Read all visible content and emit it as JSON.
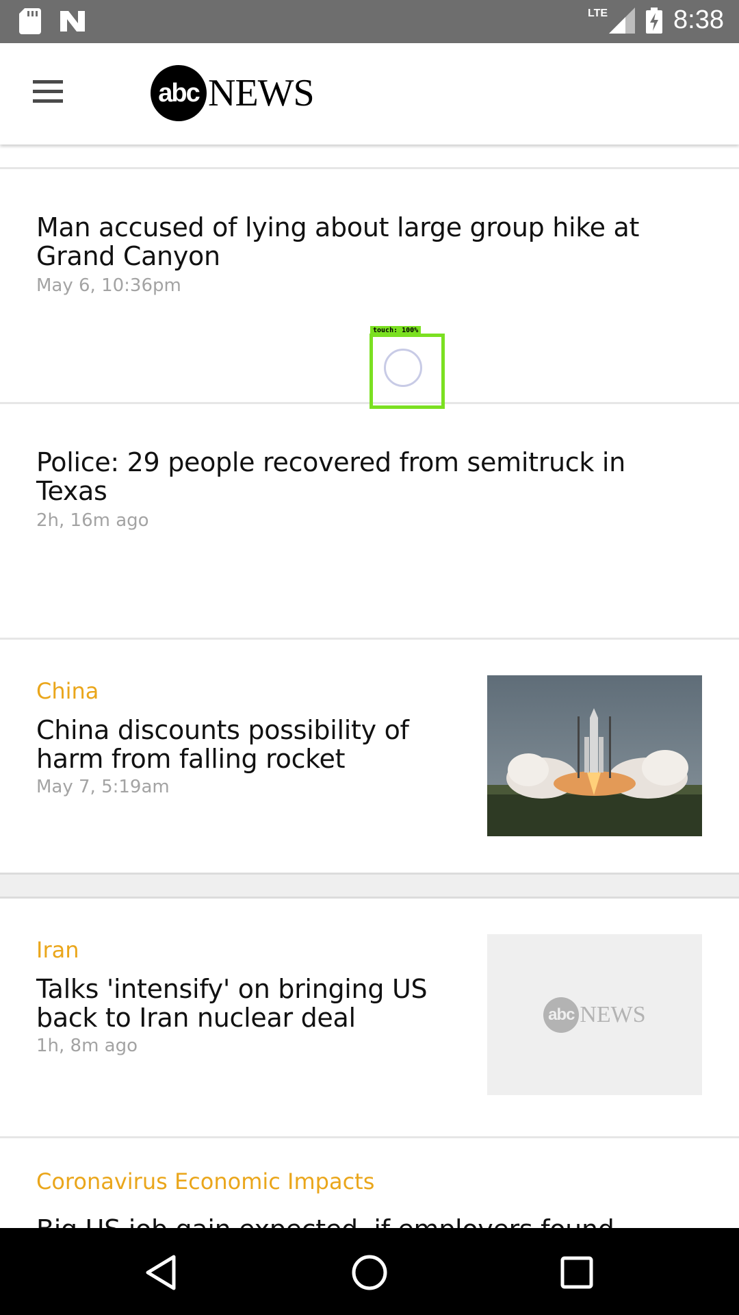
{
  "status_bar": {
    "network": "LTE",
    "time": "8:38"
  },
  "app_bar": {
    "logo_circle_text": "abc",
    "logo_news_text": "NEWS"
  },
  "stories": [
    {
      "headline": "Man accused of lying about large group hike at Grand Canyon",
      "timestamp": "May 6, 10:36pm"
    },
    {
      "headline": "Police: 29 people recovered from semitruck in Texas",
      "timestamp": "2h, 16m ago"
    },
    {
      "category": "China",
      "headline": "China discounts possibility of harm from falling rocket",
      "timestamp": "May 7, 5:19am"
    },
    {
      "category": "Iran",
      "headline": "Talks 'intensify' on bringing US back to Iran nuclear deal",
      "timestamp": "1h, 8m ago",
      "placeholder_logo": {
        "circle": "abc",
        "news": "NEWS"
      }
    },
    {
      "category": "Coronavirus Economic Impacts",
      "headline": "Big US job gain expected, if employers found"
    }
  ],
  "touch_indicator": {
    "label": "touch: 100%"
  },
  "colors": {
    "category_accent": "#eaa61b",
    "status_bar": "#6e6e6e",
    "touch_box": "#7be021"
  }
}
